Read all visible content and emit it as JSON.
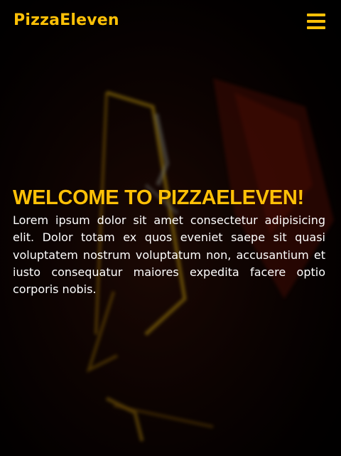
{
  "header": {
    "logo": "PizzaEleven",
    "menu_icon": "hamburger-menu-icon"
  },
  "hero": {
    "background_icon": "neon-sign-background",
    "title": "WELCOME TO PIZZAELEVEN!",
    "text": "Lorem ipsum dolor sit amet consectetur adipisicing elit. Dolor totam ex quos eveniet saepe sit quasi voluptatem nostrum voluptatum non, accusantium et iusto consequatur maiores expedita facere optio corporis nobis."
  },
  "colors": {
    "accent": "#ffc107",
    "text": "#ffffff",
    "background": "#000000"
  }
}
